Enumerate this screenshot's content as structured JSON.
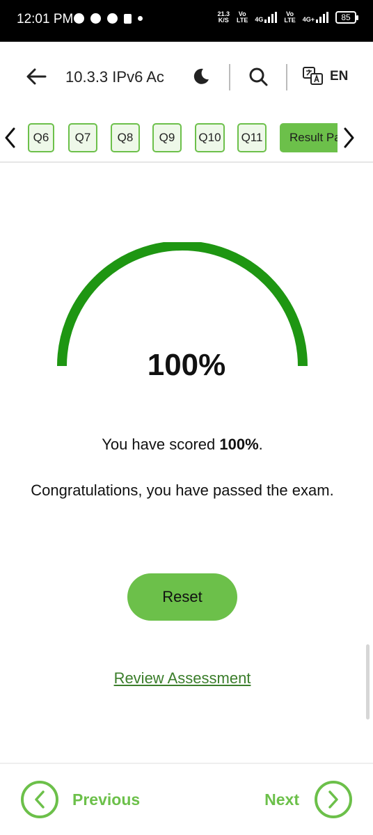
{
  "status_bar": {
    "time": "12:01 PM",
    "net_speed": "21.3",
    "net_unit": "K/S",
    "sim1_top": "Vo",
    "sim1_bottom": "LTE",
    "net1": "4G",
    "sim2_top": "Vo",
    "sim2_bottom": "LTE",
    "net2": "4G+",
    "battery": "85"
  },
  "header": {
    "title": "10.3.3 IPv6 Ac",
    "language": "EN",
    "back_icon": "arrow-left-icon",
    "theme_icon": "moon-icon",
    "search_icon": "search-icon",
    "translate_icon": "translate-icon"
  },
  "question_nav": {
    "tabs": [
      "Q6",
      "Q7",
      "Q8",
      "Q9",
      "Q10",
      "Q11"
    ],
    "result_tab": "Result Pa",
    "accent_color": "#6cc04a"
  },
  "result": {
    "score_display": "100%",
    "score_fraction": 1.0,
    "score_prefix": "You have scored ",
    "score_value": "100%",
    "score_suffix": ".",
    "message": "Congratulations, you have passed the exam.",
    "gauge_color": "#1e9612"
  },
  "actions": {
    "reset_label": "Reset",
    "review_label": "Review Assessment"
  },
  "bottom_nav": {
    "previous_label": "Previous",
    "next_label": "Next"
  }
}
